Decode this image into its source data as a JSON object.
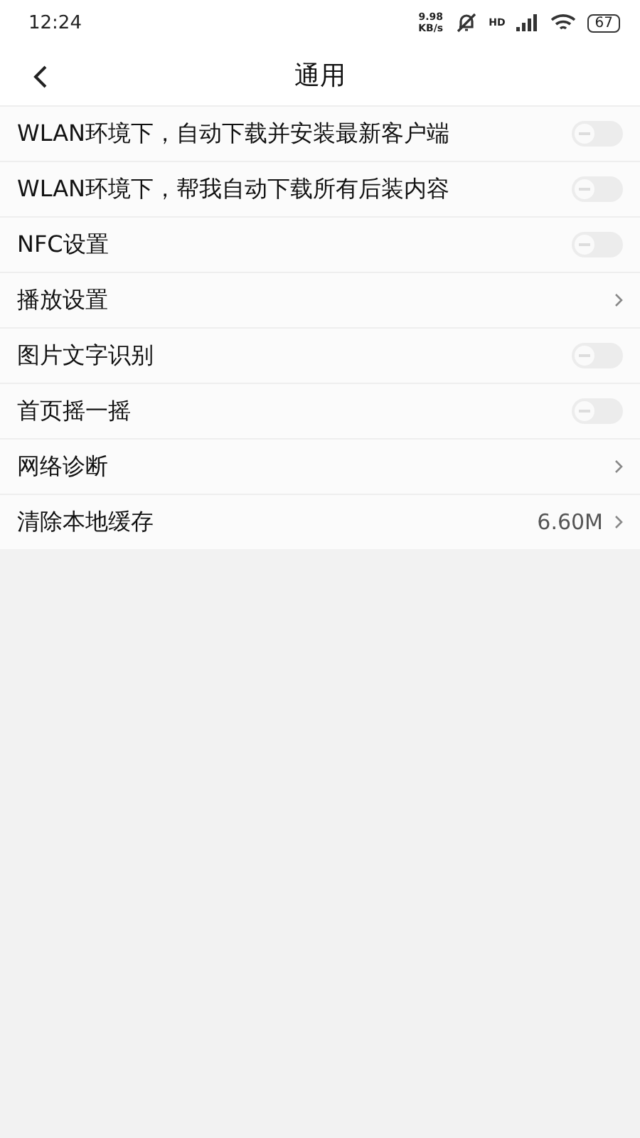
{
  "status_bar": {
    "time": "12:24",
    "speed_value": "9.98",
    "speed_unit": "KB/s",
    "network_label": "HD",
    "battery": "67"
  },
  "header": {
    "title": "通用"
  },
  "settings": [
    {
      "kind": "toggle",
      "label": "WLAN环境下，自动下载并安装最新客户端",
      "on": false
    },
    {
      "kind": "toggle",
      "label": "WLAN环境下，帮我自动下载所有后装内容",
      "on": false
    },
    {
      "kind": "toggle",
      "label": "NFC设置",
      "on": false
    },
    {
      "kind": "link",
      "label": "播放设置"
    },
    {
      "kind": "toggle",
      "label": "图片文字识别",
      "on": false
    },
    {
      "kind": "toggle",
      "label": "首页摇一摇",
      "on": false
    },
    {
      "kind": "link",
      "label": "网络诊断"
    },
    {
      "kind": "link",
      "label": "清除本地缓存",
      "value": "6.60M"
    }
  ]
}
